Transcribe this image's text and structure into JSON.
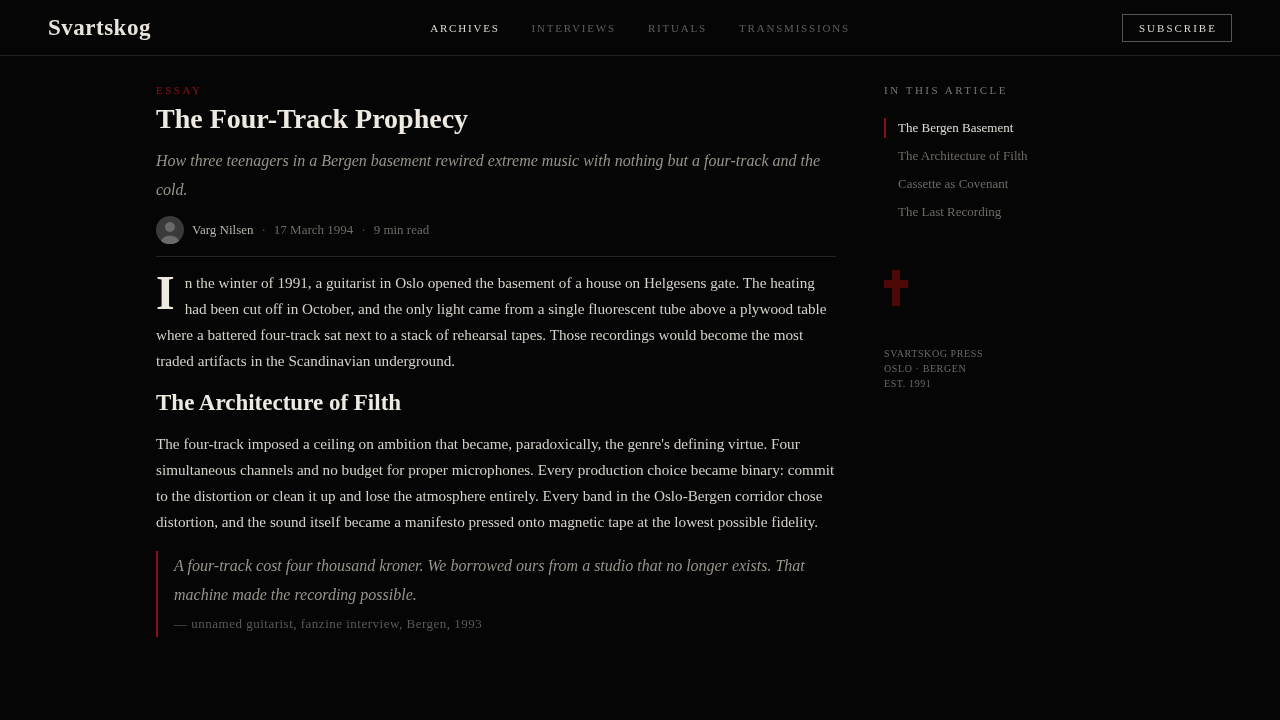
{
  "site": {
    "logo": "Svartskog",
    "nav": [
      {
        "label": "ARCHIVES",
        "selected": true
      },
      {
        "label": "INTERVIEWS",
        "selected": false
      },
      {
        "label": "RITUALS",
        "selected": false
      },
      {
        "label": "TRANSMISSIONS",
        "selected": false
      }
    ],
    "subscribe": "SUBSCRIBE"
  },
  "article": {
    "category": "ESSAY",
    "title": "The Four-Track Prophecy",
    "subtitle": "How three teenagers in a Bergen basement rewired extreme music with nothing but a four-track and the cold.",
    "meta": [
      {
        "kind": "author",
        "text": "Varg Nilsen"
      },
      {
        "kind": "separator",
        "text": "·"
      },
      {
        "kind": "info",
        "text": "17 March 1994"
      },
      {
        "kind": "separator",
        "text": "·"
      },
      {
        "kind": "info",
        "text": "9 min read"
      }
    ],
    "sections": [
      {
        "kind": "paragraph",
        "drop_cap": true,
        "text": "In the winter of 1991, a guitarist in Oslo opened the basement of a house on Helgesens gate. The heating had been cut off in October, and the only light came from a single fluorescent tube above a plywood table where a battered four-track sat next to a stack of rehearsal tapes. Those recordings would become the most traded artifacts in the Scandinavian underground."
      },
      {
        "kind": "heading",
        "text": "The Architecture of Filth"
      },
      {
        "kind": "paragraph",
        "drop_cap": false,
        "text": "The four-track imposed a ceiling on ambition that became, paradoxically, the genre's defining virtue. Four simultaneous channels and no budget for proper microphones. Every production choice became binary: commit to the distortion or clean it up and lose the atmosphere entirely. Every band in the Oslo-Bergen corridor chose distortion, and the sound itself became a manifesto pressed onto magnetic tape at the lowest possible fidelity."
      },
      {
        "kind": "quote",
        "text": "A four-track cost four thousand kroner. We borrowed ours from a studio that no longer exists. That machine made the recording possible.",
        "cite": "— unnamed guitarist, fanzine interview, Bergen, 1993"
      }
    ]
  },
  "sidebar": {
    "heading": "IN THIS ARTICLE",
    "toc": [
      {
        "label": "The Bergen Basement",
        "selected": true
      },
      {
        "label": "The Architecture of Filth",
        "selected": false
      },
      {
        "label": "Cassette as Covenant",
        "selected": false
      },
      {
        "label": "The Last Recording",
        "selected": false
      }
    ],
    "colophon": [
      "SVARTSKOG PRESS",
      "OSLO · BERGEN",
      "EST. 1991"
    ]
  }
}
